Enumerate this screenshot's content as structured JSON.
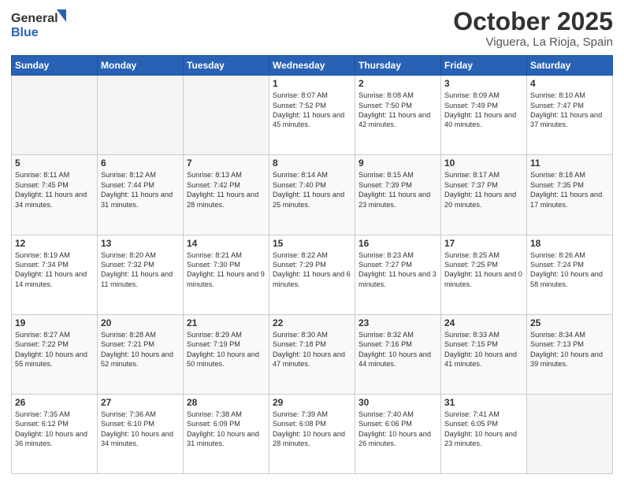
{
  "logo": {
    "line1": "General",
    "line2": "Blue"
  },
  "header": {
    "month": "October 2025",
    "location": "Viguera, La Rioja, Spain"
  },
  "weekdays": [
    "Sunday",
    "Monday",
    "Tuesday",
    "Wednesday",
    "Thursday",
    "Friday",
    "Saturday"
  ],
  "weeks": [
    [
      {
        "day": "",
        "text": ""
      },
      {
        "day": "",
        "text": ""
      },
      {
        "day": "",
        "text": ""
      },
      {
        "day": "1",
        "text": "Sunrise: 8:07 AM\nSunset: 7:52 PM\nDaylight: 11 hours and 45 minutes."
      },
      {
        "day": "2",
        "text": "Sunrise: 8:08 AM\nSunset: 7:50 PM\nDaylight: 11 hours and 42 minutes."
      },
      {
        "day": "3",
        "text": "Sunrise: 8:09 AM\nSunset: 7:49 PM\nDaylight: 11 hours and 40 minutes."
      },
      {
        "day": "4",
        "text": "Sunrise: 8:10 AM\nSunset: 7:47 PM\nDaylight: 11 hours and 37 minutes."
      }
    ],
    [
      {
        "day": "5",
        "text": "Sunrise: 8:11 AM\nSunset: 7:45 PM\nDaylight: 11 hours and 34 minutes."
      },
      {
        "day": "6",
        "text": "Sunrise: 8:12 AM\nSunset: 7:44 PM\nDaylight: 11 hours and 31 minutes."
      },
      {
        "day": "7",
        "text": "Sunrise: 8:13 AM\nSunset: 7:42 PM\nDaylight: 11 hours and 28 minutes."
      },
      {
        "day": "8",
        "text": "Sunrise: 8:14 AM\nSunset: 7:40 PM\nDaylight: 11 hours and 25 minutes."
      },
      {
        "day": "9",
        "text": "Sunrise: 8:15 AM\nSunset: 7:39 PM\nDaylight: 11 hours and 23 minutes."
      },
      {
        "day": "10",
        "text": "Sunrise: 8:17 AM\nSunset: 7:37 PM\nDaylight: 11 hours and 20 minutes."
      },
      {
        "day": "11",
        "text": "Sunrise: 8:18 AM\nSunset: 7:35 PM\nDaylight: 11 hours and 17 minutes."
      }
    ],
    [
      {
        "day": "12",
        "text": "Sunrise: 8:19 AM\nSunset: 7:34 PM\nDaylight: 11 hours and 14 minutes."
      },
      {
        "day": "13",
        "text": "Sunrise: 8:20 AM\nSunset: 7:32 PM\nDaylight: 11 hours and 11 minutes."
      },
      {
        "day": "14",
        "text": "Sunrise: 8:21 AM\nSunset: 7:30 PM\nDaylight: 11 hours and 9 minutes."
      },
      {
        "day": "15",
        "text": "Sunrise: 8:22 AM\nSunset: 7:29 PM\nDaylight: 11 hours and 6 minutes."
      },
      {
        "day": "16",
        "text": "Sunrise: 8:23 AM\nSunset: 7:27 PM\nDaylight: 11 hours and 3 minutes."
      },
      {
        "day": "17",
        "text": "Sunrise: 8:25 AM\nSunset: 7:25 PM\nDaylight: 11 hours and 0 minutes."
      },
      {
        "day": "18",
        "text": "Sunrise: 8:26 AM\nSunset: 7:24 PM\nDaylight: 10 hours and 58 minutes."
      }
    ],
    [
      {
        "day": "19",
        "text": "Sunrise: 8:27 AM\nSunset: 7:22 PM\nDaylight: 10 hours and 55 minutes."
      },
      {
        "day": "20",
        "text": "Sunrise: 8:28 AM\nSunset: 7:21 PM\nDaylight: 10 hours and 52 minutes."
      },
      {
        "day": "21",
        "text": "Sunrise: 8:29 AM\nSunset: 7:19 PM\nDaylight: 10 hours and 50 minutes."
      },
      {
        "day": "22",
        "text": "Sunrise: 8:30 AM\nSunset: 7:18 PM\nDaylight: 10 hours and 47 minutes."
      },
      {
        "day": "23",
        "text": "Sunrise: 8:32 AM\nSunset: 7:16 PM\nDaylight: 10 hours and 44 minutes."
      },
      {
        "day": "24",
        "text": "Sunrise: 8:33 AM\nSunset: 7:15 PM\nDaylight: 10 hours and 41 minutes."
      },
      {
        "day": "25",
        "text": "Sunrise: 8:34 AM\nSunset: 7:13 PM\nDaylight: 10 hours and 39 minutes."
      }
    ],
    [
      {
        "day": "26",
        "text": "Sunrise: 7:35 AM\nSunset: 6:12 PM\nDaylight: 10 hours and 36 minutes."
      },
      {
        "day": "27",
        "text": "Sunrise: 7:36 AM\nSunset: 6:10 PM\nDaylight: 10 hours and 34 minutes."
      },
      {
        "day": "28",
        "text": "Sunrise: 7:38 AM\nSunset: 6:09 PM\nDaylight: 10 hours and 31 minutes."
      },
      {
        "day": "29",
        "text": "Sunrise: 7:39 AM\nSunset: 6:08 PM\nDaylight: 10 hours and 28 minutes."
      },
      {
        "day": "30",
        "text": "Sunrise: 7:40 AM\nSunset: 6:06 PM\nDaylight: 10 hours and 26 minutes."
      },
      {
        "day": "31",
        "text": "Sunrise: 7:41 AM\nSunset: 6:05 PM\nDaylight: 10 hours and 23 minutes."
      },
      {
        "day": "",
        "text": ""
      }
    ]
  ]
}
